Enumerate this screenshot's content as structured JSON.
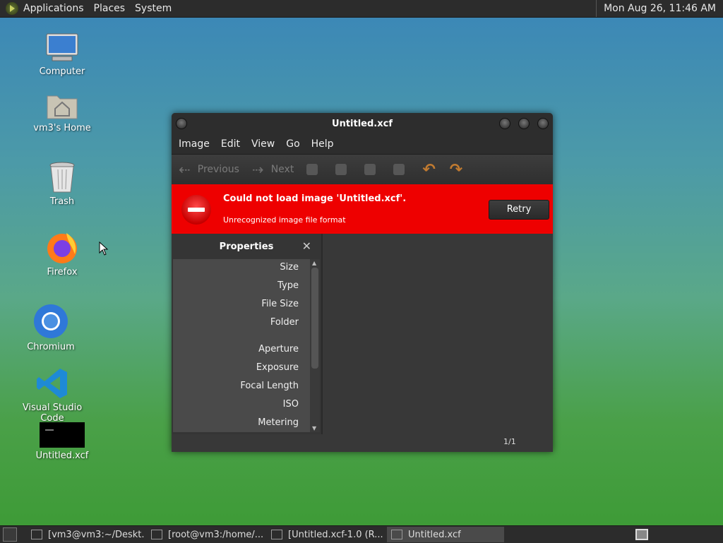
{
  "top_panel": {
    "menus": [
      "Applications",
      "Places",
      "System"
    ],
    "clock": "Mon Aug 26, 11:46 AM"
  },
  "desktop_icons": [
    {
      "label": "Computer",
      "icon": "computer-icon"
    },
    {
      "label": "vm3's Home",
      "icon": "home-folder-icon"
    },
    {
      "label": "Trash",
      "icon": "trash-icon"
    },
    {
      "label": "Firefox",
      "icon": "firefox-icon"
    },
    {
      "label": "Chromium",
      "icon": "chromium-icon"
    },
    {
      "label": "Visual Studio Code",
      "icon": "vscode-icon"
    },
    {
      "label": "Untitled.xcf",
      "icon": "image-file-icon"
    }
  ],
  "window": {
    "title": "Untitled.xcf",
    "menu": [
      "Image",
      "Edit",
      "View",
      "Go",
      "Help"
    ],
    "toolbar": {
      "previous": "Previous",
      "next": "Next"
    },
    "error": {
      "title": "Could not load image 'Untitled.xcf'.",
      "subtitle": "Unrecognized image file format",
      "retry": "Retry",
      "color": "#ee0000"
    },
    "properties": {
      "title": "Properties",
      "close": "✕",
      "rows": [
        "Size",
        "Type",
        "File Size",
        "Folder",
        "Aperture",
        "Exposure",
        "Focal Length",
        "ISO",
        "Metering"
      ]
    },
    "page_count": "1/1"
  },
  "taskbar": {
    "tasks": [
      {
        "label": "[vm3@vm3:~/Deskt..."
      },
      {
        "label": "[root@vm3:/home/..."
      },
      {
        "label": "[Untitled.xcf-1.0 (R..."
      },
      {
        "label": "Untitled.xcf"
      }
    ]
  }
}
